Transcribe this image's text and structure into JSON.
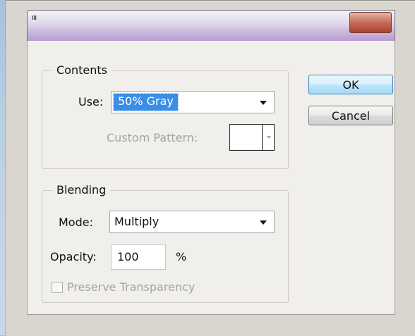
{
  "contents": {
    "legend": "Contents",
    "use_label": "Use:",
    "use_value": "50% Gray",
    "custom_pattern_label": "Custom Pattern:"
  },
  "blending": {
    "legend": "Blending",
    "mode_label": "Mode:",
    "mode_value": "Multiply",
    "opacity_label": "Opacity:",
    "opacity_value": "100",
    "opacity_unit": "%",
    "preserve_label": "Preserve Transparency",
    "preserve_checked": false
  },
  "buttons": {
    "ok": "OK",
    "cancel": "Cancel"
  },
  "colors": {
    "selection": "#3a8ee6",
    "close_button": "#c86a57",
    "default_button_border": "#3c7fb1"
  },
  "icons": {
    "title_grip": "grip-icon",
    "dropdown": "chevron-down-icon",
    "close": "close-icon"
  }
}
